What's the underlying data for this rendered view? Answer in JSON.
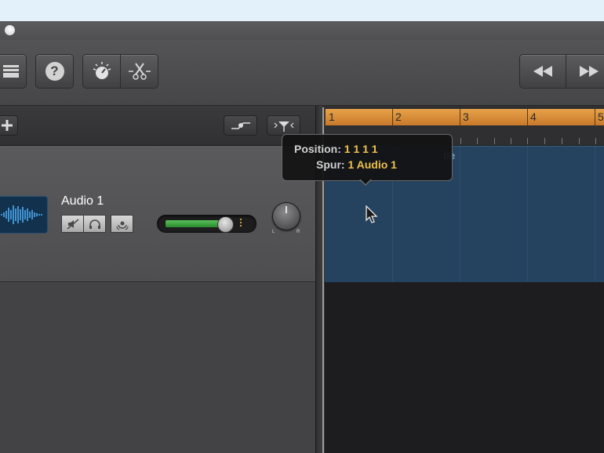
{
  "tooltip": {
    "position_label": "Position:",
    "position_value": "1 1 1 1",
    "track_label": "Spur:",
    "track_number": "1",
    "track_name": "Audio 1"
  },
  "track": {
    "name": "Audio 1",
    "volume_level_fraction": 0.75
  },
  "timeline": {
    "bars": [
      "1",
      "2",
      "3",
      "4",
      "5"
    ],
    "region_title_partial": "tle"
  },
  "pan": {
    "left": "L",
    "right": "R"
  },
  "colors": {
    "cycle": "#d88b34",
    "region": "#25425f",
    "tooltip_value": "#f0c14a",
    "volume_fill": "#4caf50"
  },
  "icons": {
    "toolbar": [
      "library-icon",
      "help-icon",
      "smart-controls-icon",
      "scissors-icon",
      "rewind-icon",
      "forward-icon"
    ],
    "track_controls": [
      "mute-icon",
      "headphones-icon",
      "record-enable-icon"
    ]
  }
}
